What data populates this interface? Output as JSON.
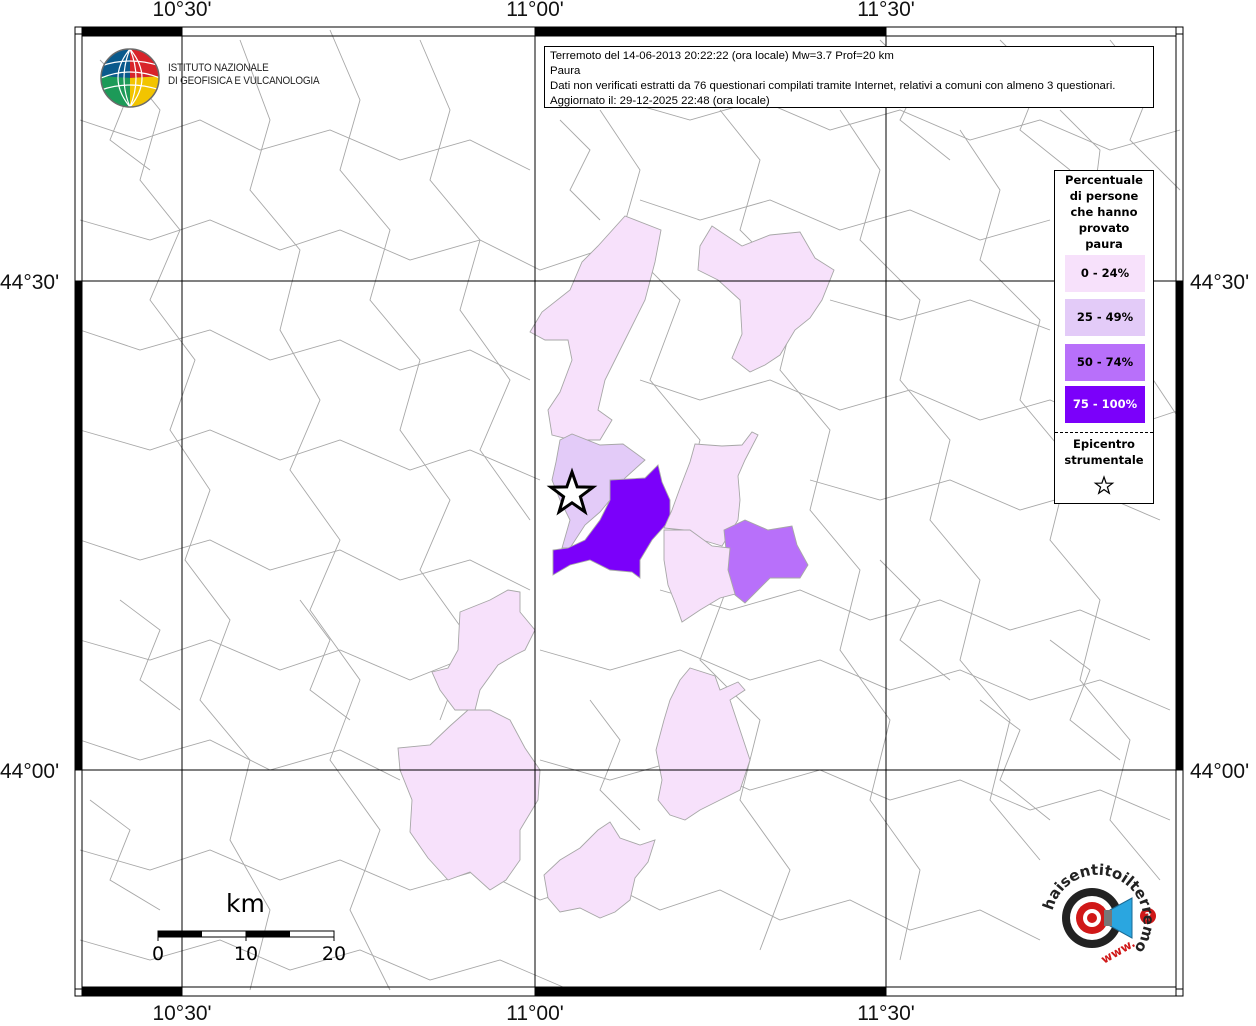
{
  "map": {
    "colors": {
      "class_0_24": "#f7e1fb",
      "class_25_49": "#e3cbf8",
      "class_50_74": "#b870fa",
      "class_75_100": "#7b00fa",
      "borders": "#a7a7a7",
      "frame": "#000000"
    },
    "lon_labels": [
      "10°30'",
      "11°00'",
      "11°30'"
    ],
    "lat_labels": [
      "44°30'",
      "44°00'"
    ]
  },
  "info": {
    "line1": "Terremoto del 14-06-2013 20:22:22 (ora locale) Mw=3.7 Prof=20 km",
    "line2": "Paura",
    "line3": "Dati non verificati estratti da 76 questionari compilati tramite Internet, relativi a comuni con almeno 3 questionari.",
    "line4": "Aggiornato il: 29-12-2025 22:48 (ora locale)"
  },
  "ingv": {
    "line1": "ISTITUTO NAZIONALE",
    "line2": "DI GEOFISICA E VULCANOLOGIA"
  },
  "legend": {
    "title_lines": [
      "Percentuale",
      "di persone",
      "che hanno",
      "provato",
      "paura"
    ],
    "classes": [
      {
        "label": "0 - 24%",
        "color": "#f7e1fb",
        "text_color": "#000000"
      },
      {
        "label": "25 - 49%",
        "color": "#e3cbf8",
        "text_color": "#000000"
      },
      {
        "label": "50 - 74%",
        "color": "#b870fa",
        "text_color": "#000000"
      },
      {
        "label": "75 - 100%",
        "color": "#7b00fa",
        "text_color": "#ffffff"
      }
    ],
    "epicenter_lines": [
      "Epicentro",
      "strumentale"
    ],
    "epicenter_icon": "star-outline-icon"
  },
  "scale_bar": {
    "unit": "km",
    "ticks": [
      "0",
      "10",
      "20"
    ]
  },
  "hst_logo": {
    "text": "haisentitoilterremoto.it",
    "prefix": "www."
  }
}
